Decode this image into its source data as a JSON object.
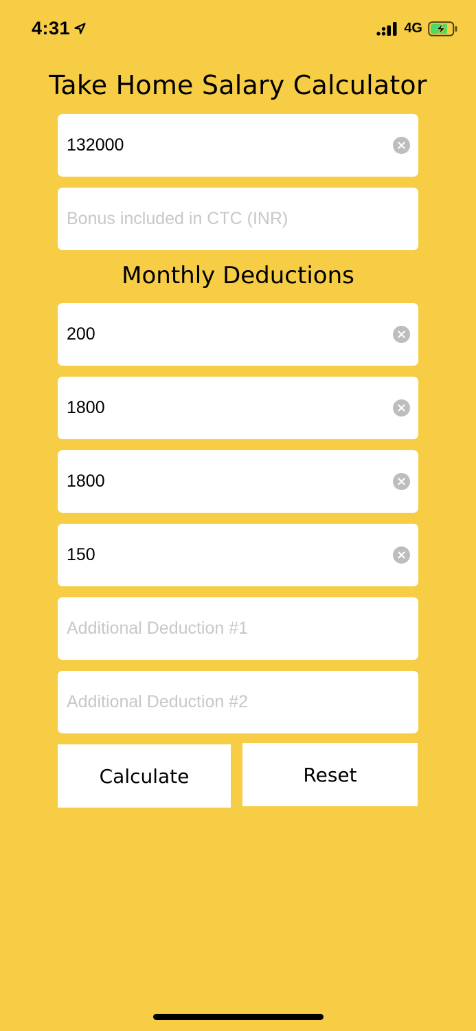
{
  "status_bar": {
    "time": "4:31",
    "network": "4G"
  },
  "title": "Take Home Salary Calculator",
  "ctc_field": {
    "value": "132000",
    "placeholder": ""
  },
  "bonus_field": {
    "value": "",
    "placeholder": "Bonus included in CTC (INR)"
  },
  "section_heading": "Monthly Deductions",
  "deductions": [
    {
      "value": "200"
    },
    {
      "value": "1800"
    },
    {
      "value": "1800"
    },
    {
      "value": "150"
    }
  ],
  "additional_deduction_1": {
    "value": "",
    "placeholder": "Additional Deduction #1"
  },
  "additional_deduction_2": {
    "value": "",
    "placeholder": "Additional Deduction #2"
  },
  "buttons": {
    "calculate": "Calculate",
    "reset": "Reset"
  },
  "colors": {
    "background": "#F6CD45",
    "field": "#FFFFFF",
    "placeholder": "#C7C7CC",
    "clear_icon": "#BDBDBD",
    "battery_charge": "#4CD964"
  },
  "icons": {
    "location": "location-arrow-icon",
    "signal": "cellular-signal-icon",
    "battery": "battery-charging-icon",
    "clear": "clear-circle-icon"
  }
}
